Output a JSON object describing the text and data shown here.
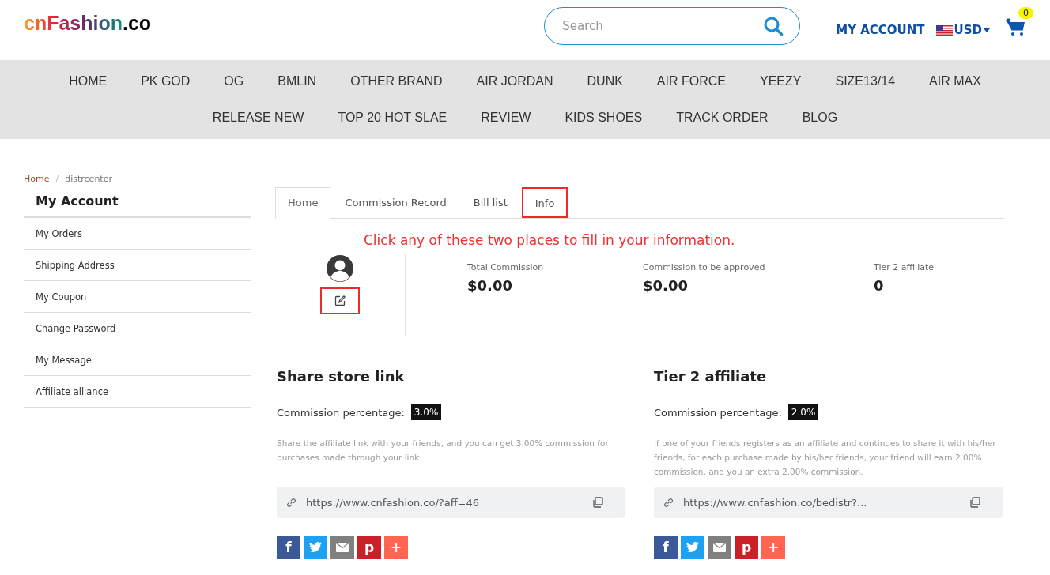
{
  "header": {
    "logo": {
      "name": "cnFashion",
      "suffix": ".co"
    },
    "search": {
      "placeholder": "Search"
    },
    "account": "MY ACCOUNT",
    "currency": "USD",
    "cart_count": "0"
  },
  "nav": {
    "items": [
      "HOME",
      "PK GOD",
      "OG",
      "BMLIN",
      "OTHER BRAND",
      "AIR JORDAN",
      "DUNK",
      "AIR FORCE",
      "YEEZY",
      "SIZE13/14",
      "AIR MAX",
      "RELEASE NEW",
      "TOP 20 HOT SLAE",
      "REVIEW",
      "KIDS SHOES",
      "TRACK ORDER",
      "BLOG"
    ]
  },
  "breadcrumb": {
    "items": [
      "Home",
      "distrcenter"
    ],
    "separator": "/"
  },
  "sidebar": {
    "title": "My Account",
    "items": [
      "My Orders",
      "Shipping Address",
      "My Coupon",
      "Change Password",
      "My Message",
      "Affiliate alliance"
    ]
  },
  "tabs": [
    {
      "label": "Home",
      "selected": true,
      "highlighted": false
    },
    {
      "label": "Commission Record",
      "selected": false,
      "highlighted": false
    },
    {
      "label": "Bill list",
      "selected": false,
      "highlighted": false
    },
    {
      "label": "Info",
      "selected": false,
      "highlighted": true
    }
  ],
  "annotation": "Click any of these two places to fill in your information.",
  "profile": {
    "edit_highlighted": true
  },
  "stats": [
    {
      "label": "Total Commission",
      "value": "$0.00"
    },
    {
      "label": "Commission to be approved",
      "value": "$0.00"
    },
    {
      "label": "Tier 2 affiliate",
      "value": "0"
    }
  ],
  "sections": [
    {
      "title": "Share store link",
      "commission_label": "Commission percentage:",
      "commission": "3.0%",
      "description": "Share the affiliate link with your friends, and you can get 3.00% commission for purchases made through your link.",
      "link": "https://www.cnfashion.co/?aff=46",
      "share": [
        {
          "kind": "facebook",
          "glyph": "f"
        },
        {
          "kind": "twitter"
        },
        {
          "kind": "email"
        },
        {
          "kind": "pinterest",
          "glyph": "p"
        },
        {
          "kind": "more",
          "glyph": "+"
        }
      ]
    },
    {
      "title": "Tier 2 affiliate",
      "commission_label": "Commission percentage:",
      "commission": "2.0%",
      "description": "If one of your friends registers as an affiliate and continues to share it with his/her friends, for each purchase made by his/her friends, your friend will earn 2.00% commission, and you an extra 2.00% commission.",
      "link": "https://www.cnfashion.co/bedistr?...",
      "share": [
        {
          "kind": "facebook",
          "glyph": "f"
        },
        {
          "kind": "twitter"
        },
        {
          "kind": "email"
        },
        {
          "kind": "pinterest",
          "glyph": "p"
        },
        {
          "kind": "more",
          "glyph": "+"
        }
      ]
    }
  ]
}
